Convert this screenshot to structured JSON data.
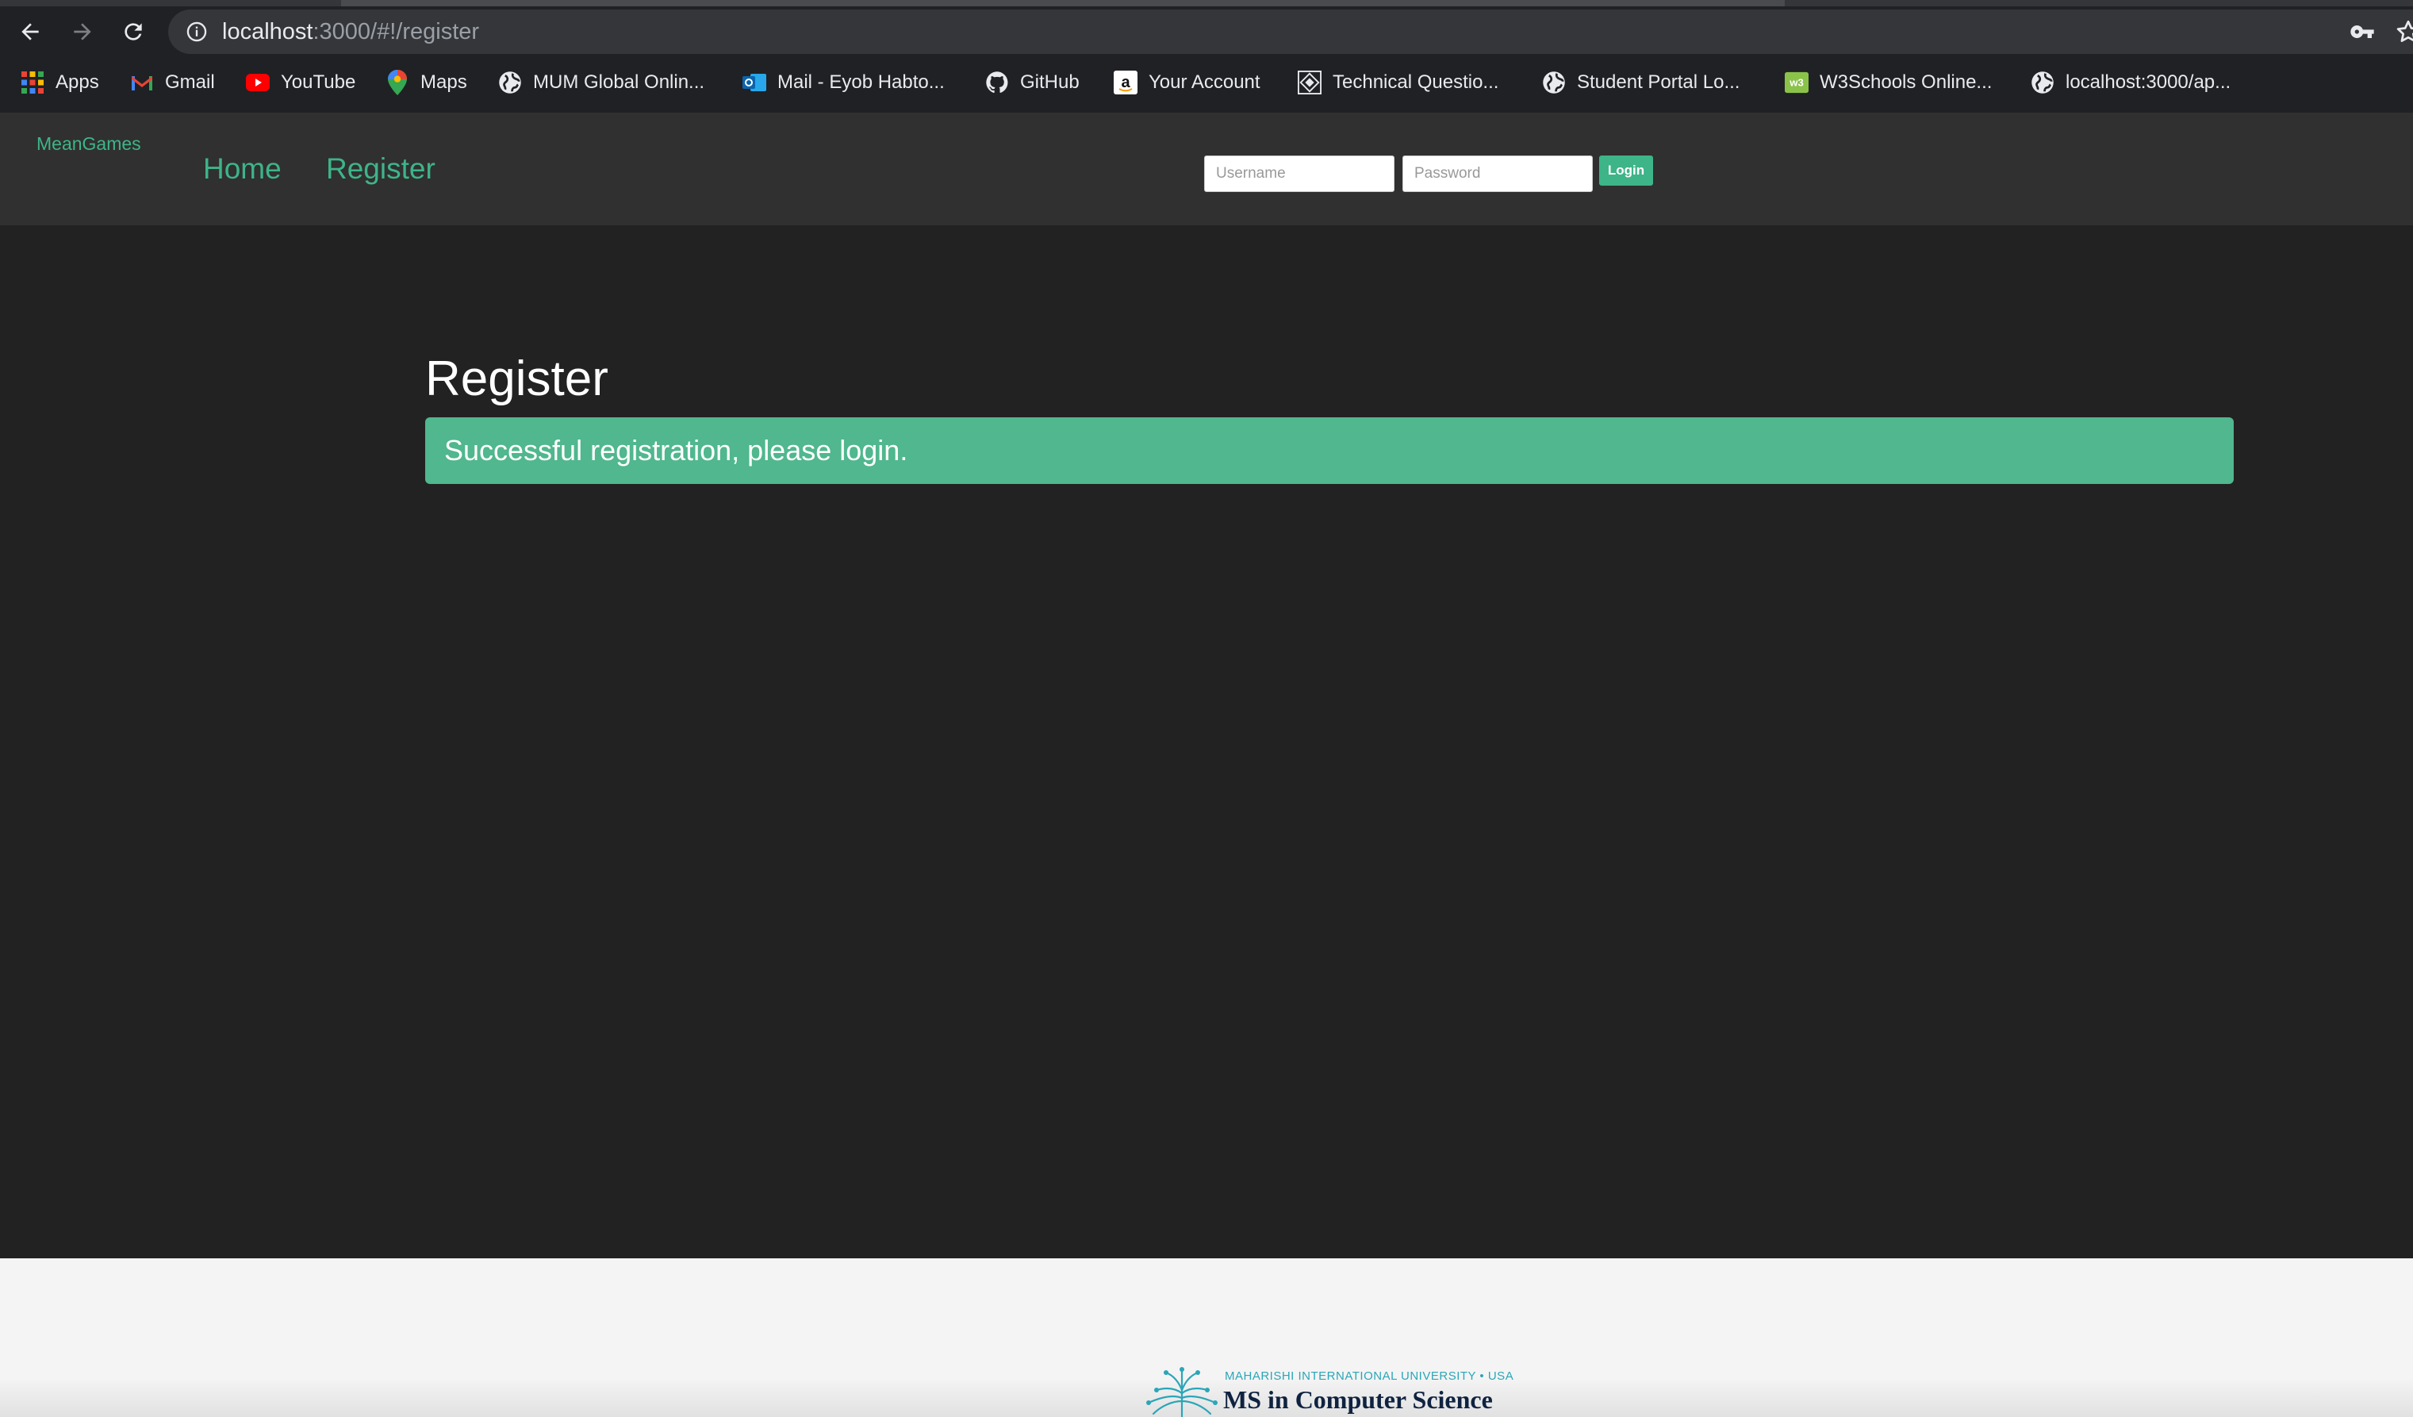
{
  "browser": {
    "url_host": "localhost",
    "url_rest": ":3000/#!/register",
    "bookmarks": [
      {
        "label": "Apps",
        "icon": "apps-grid-icon"
      },
      {
        "label": "Gmail",
        "icon": "gmail-icon"
      },
      {
        "label": "YouTube",
        "icon": "youtube-icon"
      },
      {
        "label": "Maps",
        "icon": "maps-pin-icon"
      },
      {
        "label": "MUM Global Onlin...",
        "icon": "globe-icon"
      },
      {
        "label": "Mail - Eyob Habto...",
        "icon": "outlook-icon"
      },
      {
        "label": "GitHub",
        "icon": "github-icon"
      },
      {
        "label": "Your Account",
        "icon": "amazon-icon"
      },
      {
        "label": "Technical Questio...",
        "icon": "site-icon"
      },
      {
        "label": "Student Portal Lo...",
        "icon": "globe-icon"
      },
      {
        "label": "W3Schools Online...",
        "icon": "w3schools-icon"
      },
      {
        "label": "localhost:3000/ap...",
        "icon": "globe-icon"
      }
    ]
  },
  "navbar": {
    "brand": "MeanGames",
    "links": [
      "Home",
      "Register"
    ],
    "username_placeholder": "Username",
    "password_placeholder": "Password",
    "login_label": "Login"
  },
  "main": {
    "title": "Register",
    "alert": "Successful registration, please login."
  },
  "footer": {
    "university": "MAHARISHI INTERNATIONAL UNIVERSITY • USA",
    "program": "MS in Computer Science"
  },
  "colors": {
    "accent": "#3eb489",
    "alert_bg": "#50b78e",
    "page_bg": "#222222",
    "navbar_bg": "#303030",
    "footer_bg": "#f4f4f4"
  }
}
